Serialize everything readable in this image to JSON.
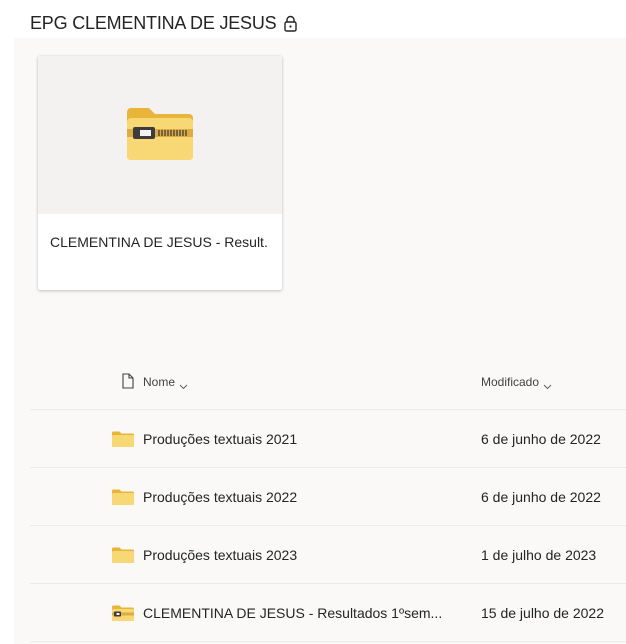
{
  "header": {
    "title": "EPG CLEMENTINA DE JESUS",
    "lock_icon": "lock-icon"
  },
  "card": {
    "name": "CLEMENTINA DE JESUS - Result.",
    "icon": "zip-folder-icon"
  },
  "list": {
    "columns": {
      "type_icon": "file-type-icon",
      "name": "Nome",
      "modified": "Modificado"
    },
    "rows": [
      {
        "icon": "folder-icon",
        "name": "Produções textuais 2021",
        "modified": "6 de junho de 2022"
      },
      {
        "icon": "folder-icon",
        "name": "Produções textuais 2022",
        "modified": "6 de junho de 2022"
      },
      {
        "icon": "folder-icon",
        "name": "Produções textuais 2023",
        "modified": "1 de julho de 2023"
      },
      {
        "icon": "zip-folder-icon",
        "name": "CLEMENTINA DE JESUS - Resultados 1ºsem...",
        "modified": "15 de julho de 2022"
      }
    ]
  },
  "colors": {
    "folder": "#f8d775",
    "folder_dark": "#e8b43a",
    "background": "#faf9f8"
  }
}
